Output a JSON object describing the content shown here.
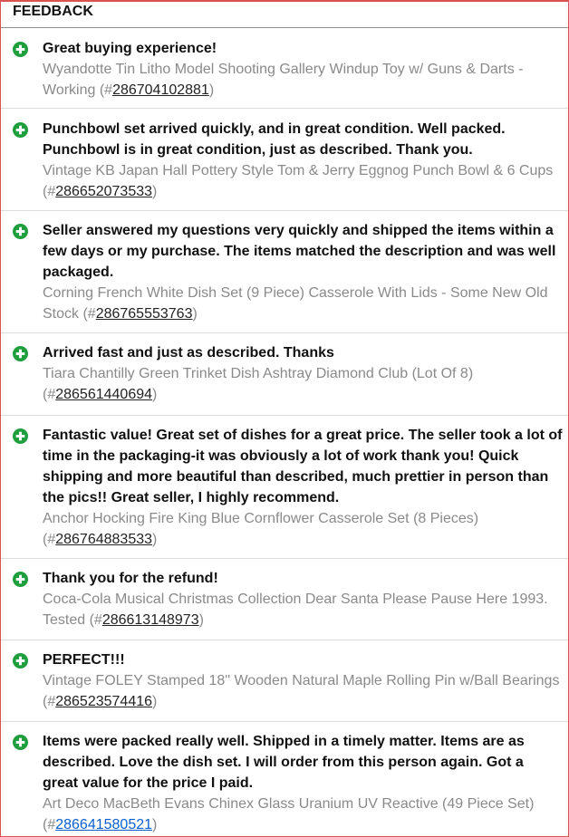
{
  "header": {
    "title": "FEEDBACK"
  },
  "entries": [
    {
      "comment": "Great buying experience!",
      "item_text": "Wyandotte Tin Litho Model Shooting Gallery Windup Toy w/ Guns & Darts - Working (#",
      "item_number": "286704102881",
      "item_close": ")"
    },
    {
      "comment": "Punchbowl set arrived quickly, and in great condition. Well packed. Punchbowl is in great condition, just as described. Thank you.",
      "item_text": "Vintage KB Japan Hall Pottery Style Tom & Jerry Eggnog Punch Bowl & 6 Cups (#",
      "item_number": "286652073533",
      "item_close": ")"
    },
    {
      "comment": "Seller answered my questions very quickly and shipped the items within a few days or my purchase. The items matched the description and was well packaged.",
      "item_text": "Corning French White Dish Set (9 Piece) Casserole With Lids - Some New Old Stock (#",
      "item_number": "286765553763",
      "item_close": ")"
    },
    {
      "comment": "Arrived fast and just as described. Thanks",
      "item_text": "Tiara Chantilly Green Trinket Dish Ashtray Diamond Club (Lot Of 8) (#",
      "item_number": "286561440694",
      "item_close": ")"
    },
    {
      "comment": "Fantastic value! Great set of dishes for a great price. The seller took a lot of time in the packaging-it was obviously a lot of work thank you! Quick shipping and more beautiful than described, much prettier in person than the pics!! Great seller, I highly recommend.",
      "item_text": "Anchor Hocking Fire King Blue Cornflower Casserole Set (8 Pieces) (#",
      "item_number": "286764883533",
      "item_close": ")"
    },
    {
      "comment": "Thank you for the refund!",
      "item_text": "Coca-Cola Musical Christmas Collection Dear Santa Please Pause Here 1993. Tested (#",
      "item_number": "286613148973",
      "item_close": ")"
    },
    {
      "comment": "PERFECT!!!",
      "item_text": "Vintage FOLEY Stamped 18\" Wooden Natural Maple Rolling Pin w/Ball Bearings (#",
      "item_number": "286523574416",
      "item_close": ")"
    },
    {
      "comment": "Items were packed really well. Shipped in a timely matter. Items are as described. Love the dish set. I will order from this person again. Got a great value for the price I paid.",
      "item_text": "Art Deco MacBeth Evans Chinex Glass Uranium UV Reactive (49 Piece Set) (#",
      "item_number": "286641580521",
      "item_close": ")"
    }
  ],
  "colors": {
    "positive_icon": "#1e9e3c",
    "frame_border": "#d9534f"
  },
  "icons": {
    "positive": "plus-circle-icon"
  }
}
